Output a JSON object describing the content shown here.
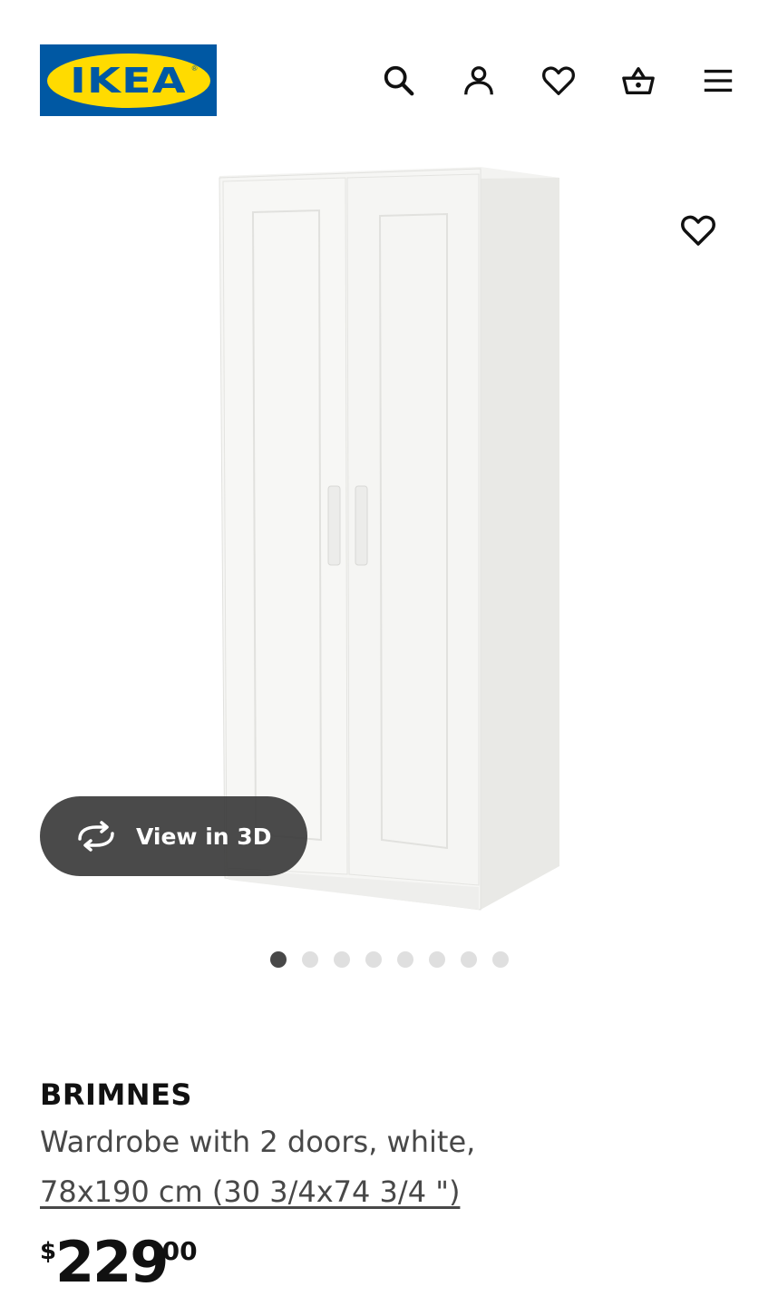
{
  "header": {
    "logo_text": "IKEA",
    "logo_registered": "®",
    "icons": [
      "search-icon",
      "account-icon",
      "favorites-icon",
      "cart-icon",
      "menu-icon"
    ]
  },
  "gallery": {
    "view_3d_label": "View in 3D",
    "slide_count": 8,
    "active_slide": 1
  },
  "product": {
    "name": "BRIMNES",
    "description": "Wardrobe with 2 doors, white,",
    "size": "78x190 cm (30 3/4x74 3/4 \")",
    "price": {
      "currency": "$",
      "integer": "229",
      "decimal": ".00"
    }
  },
  "colors": {
    "brand_blue": "#0058a3",
    "brand_yellow": "#ffdb00"
  }
}
